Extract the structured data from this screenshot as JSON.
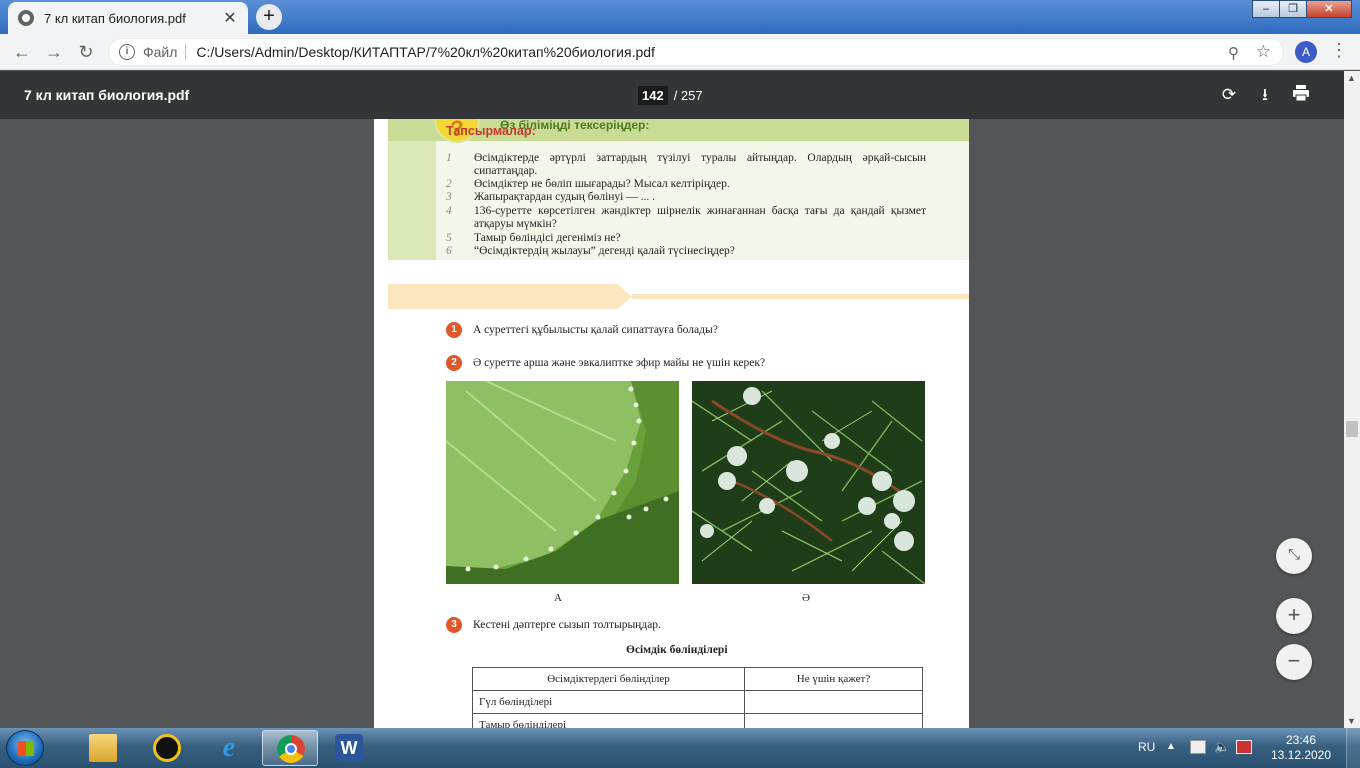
{
  "browser": {
    "tab_title": "7 кл китап биология.pdf",
    "tab_close": "✕",
    "new_tab": "+",
    "url_scheme": "Файл",
    "url": "C:/Users/Admin/Desktop/КИТАПТАР/7%20кл%20китап%20биология.pdf",
    "avatar_letter": "A",
    "window_controls": [
      "–",
      "❐",
      "✕"
    ]
  },
  "pdf_toolbar": {
    "title": "7 кл китап биология.pdf",
    "current_page": "142",
    "total_pages": "/ 257",
    "icons": [
      "rotate-icon",
      "download-icon",
      "print-icon"
    ]
  },
  "page": {
    "check_title": "Өз біліміңді тексеріңдер:",
    "badge": "?",
    "questions": [
      {
        "n": "1",
        "text": "Өсімдіктерде әртүрлі заттардың түзілуі туралы айтыңдар. Олардың әрқай-сысын сипаттаңдар."
      },
      {
        "n": "2",
        "text": "Өсімдіктер не бөліп шығарады? Мысал келтіріңдер."
      },
      {
        "n": "3",
        "text": "Жапырақтардан судың бөлінуі — ... ."
      },
      {
        "n": "4",
        "text": "136-суретте көрсетілген жәндіктер шірнелік жинағаннан басқа тағы да қандай қызмет атқаруы мүмкін?"
      },
      {
        "n": "5",
        "text": "Тамыр бөліндісі дегеніміз не?"
      },
      {
        "n": "6",
        "text": "“Өсімдіктердің жылауы” дегенді қалай түсінесіңдер?"
      }
    ],
    "tasks_title": "Тапсырмалар:",
    "tasks": [
      {
        "n": "1",
        "text": "А суреттегі құбылысты қалай сипаттауға болады?"
      },
      {
        "n": "2",
        "text": "Ә суретте арша және эвкалиптке эфир майы не үшін керек?"
      },
      {
        "n": "3",
        "text": "Кестені дәптерге сызып толтырыңдар."
      }
    ],
    "caption_a": "А",
    "caption_b": "Ә",
    "table_title": "Өсімдік бөлінділері",
    "table_headers": [
      "Өсімдіктердегі бөліндiлер",
      "Не үшін қажет?"
    ],
    "table_rows": [
      "Гүл бөліндiлері",
      "Тамыр бөліндiлері"
    ]
  },
  "zoom_controls": {
    "fit": "⤡",
    "plus": "+",
    "minus": "−"
  },
  "taskbar": {
    "apps": [
      "file-explorer-icon",
      "app-launcher-icon",
      "internet-explorer-icon",
      "chrome-icon",
      "word-icon"
    ],
    "language": "RU",
    "time": "23:46",
    "date": "13.12.2020"
  }
}
